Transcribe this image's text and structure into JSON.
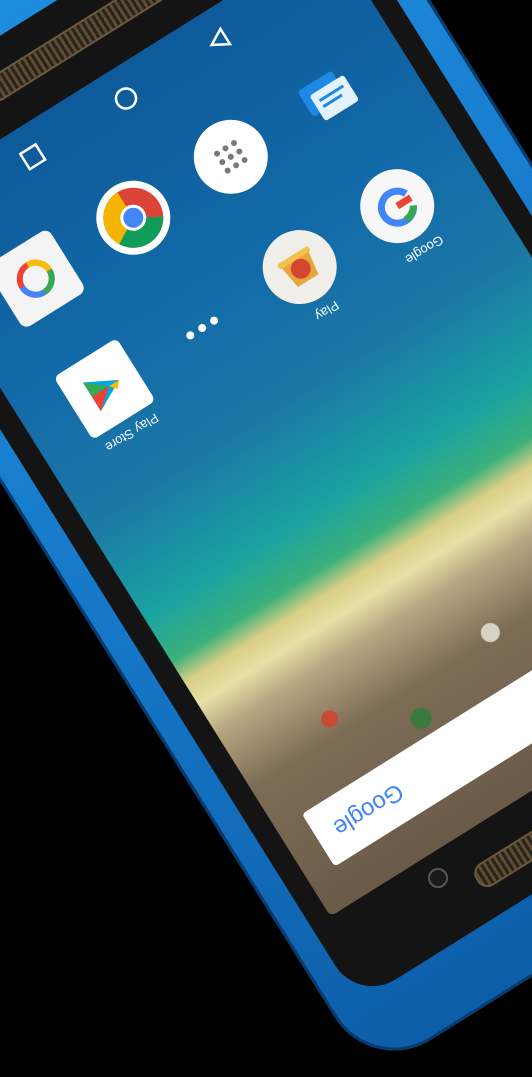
{
  "screen": {
    "nav": {
      "back_icon": "triangle-back-icon",
      "home_icon": "circle-home-icon",
      "recents_icon": "square-recents-icon"
    },
    "row1": [
      {
        "name": "photos-icon",
        "label": ""
      },
      {
        "name": "chrome-icon",
        "label": ""
      },
      {
        "name": "app-drawer-icon",
        "label": ""
      },
      {
        "name": "messages-icon",
        "label": ""
      }
    ],
    "row2": [
      {
        "name": "play-store-icon",
        "label": "Play Store"
      },
      {
        "name": "more-dots-icon",
        "label": ""
      },
      {
        "name": "play-games-icon",
        "label": "Play"
      },
      {
        "name": "google-app-icon",
        "label": "Google"
      }
    ],
    "search": {
      "text": "Google"
    }
  },
  "colors": {
    "phone_body": "#1f8fe0",
    "bezel": "#141414",
    "ocean_deep": "#0e5a9a",
    "ocean_shallow": "#1aa3a0",
    "sand": "#e8dfa6"
  }
}
